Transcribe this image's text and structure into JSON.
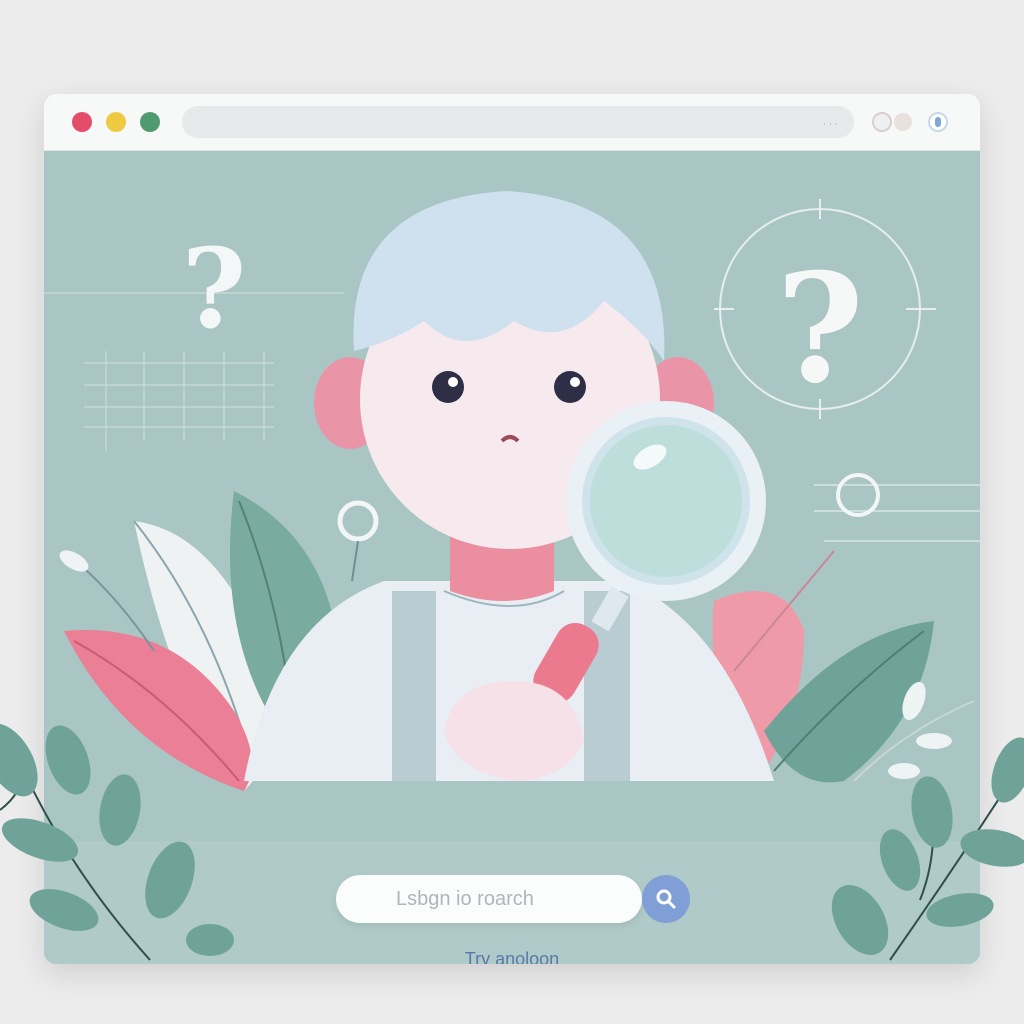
{
  "browser": {
    "window_controls": [
      "close",
      "minimize",
      "maximize"
    ],
    "address_bar_value": "",
    "address_bar_menu": "...",
    "toolbar_icons": [
      "extension-icon",
      "profile-icon",
      "shield-icon"
    ]
  },
  "illustration": {
    "question_marks": [
      "?",
      "?"
    ]
  },
  "search": {
    "placeholder": "Lsbgn io roarch",
    "button_icon": "search-icon"
  },
  "try_again": {
    "label": "Try anoloon"
  },
  "colors": {
    "background": "#ececec",
    "page_bg": "#a9c6c4",
    "footer_bg": "#afcac8",
    "accent_blue": "#7f9fd6",
    "accent_pink": "#ea7f95",
    "leaf_green": "#6fa39a"
  }
}
